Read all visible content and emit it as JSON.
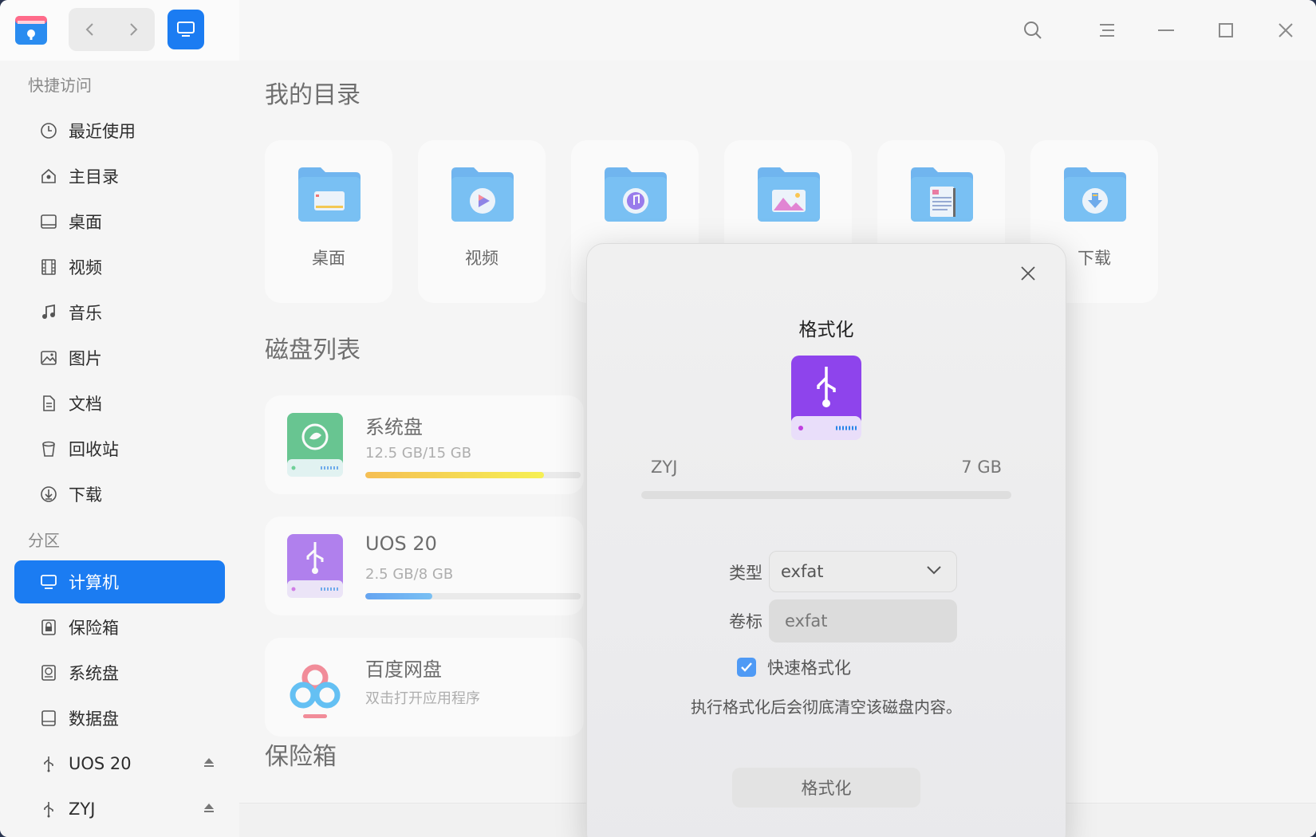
{
  "sidebar": {
    "quick_access_title": "快捷访问",
    "quick_items": [
      {
        "label": "最近使用",
        "icon": "clock-icon"
      },
      {
        "label": "主目录",
        "icon": "home-icon"
      },
      {
        "label": "桌面",
        "icon": "desktop-icon"
      },
      {
        "label": "视频",
        "icon": "film-icon"
      },
      {
        "label": "音乐",
        "icon": "music-icon"
      },
      {
        "label": "图片",
        "icon": "image-icon"
      },
      {
        "label": "文档",
        "icon": "document-icon"
      },
      {
        "label": "回收站",
        "icon": "trash-icon"
      },
      {
        "label": "下载",
        "icon": "download-icon"
      }
    ],
    "partition_title": "分区",
    "partition_items": [
      {
        "label": "计算机",
        "icon": "computer-icon",
        "active": true
      },
      {
        "label": "保险箱",
        "icon": "vault-icon"
      },
      {
        "label": "系统盘",
        "icon": "system-disk-icon"
      },
      {
        "label": "数据盘",
        "icon": "data-disk-icon"
      },
      {
        "label": "UOS 20",
        "icon": "usb-icon",
        "eject": true
      },
      {
        "label": "ZYJ",
        "icon": "usb-icon",
        "eject": true
      }
    ]
  },
  "main": {
    "my_dirs_title": "我的目录",
    "folders": [
      {
        "label": "桌面",
        "icon": "desktop-folder-icon"
      },
      {
        "label": "视频",
        "icon": "video-folder-icon"
      },
      {
        "label": "",
        "icon": "music-folder-icon"
      },
      {
        "label": "",
        "icon": "pictures-folder-icon"
      },
      {
        "label": "",
        "icon": "documents-folder-icon"
      },
      {
        "label": "下载",
        "icon": "download-folder-icon"
      }
    ],
    "disk_list_title": "磁盘列表",
    "disks": [
      {
        "name": "系统盘",
        "size": "12.5 GB/15 GB",
        "usage": 0.83,
        "bar_color": "#f9b400"
      },
      {
        "name": "UOS 20",
        "size": "2.5 GB/8 GB",
        "usage": 0.31,
        "bar_color": "#1b7cf2"
      },
      {
        "name": "百度网盘",
        "size": "双击打开应用程序"
      }
    ],
    "vault_title": "保险箱"
  },
  "dialog": {
    "title": "格式化",
    "disk_name": "ZYJ",
    "capacity": "7 GB",
    "type_label": "类型",
    "type_value": "exfat",
    "volume_label": "卷标",
    "volume_value": "exfat",
    "quick_format_label": "快速格式化",
    "quick_format_checked": true,
    "warning": "执行格式化后会彻底清空该磁盘内容。",
    "format_button": "格式化"
  },
  "colors": {
    "accent": "#1b7cf2",
    "usb_purple": "#8e44ec",
    "system_green": "#1fae5f"
  }
}
